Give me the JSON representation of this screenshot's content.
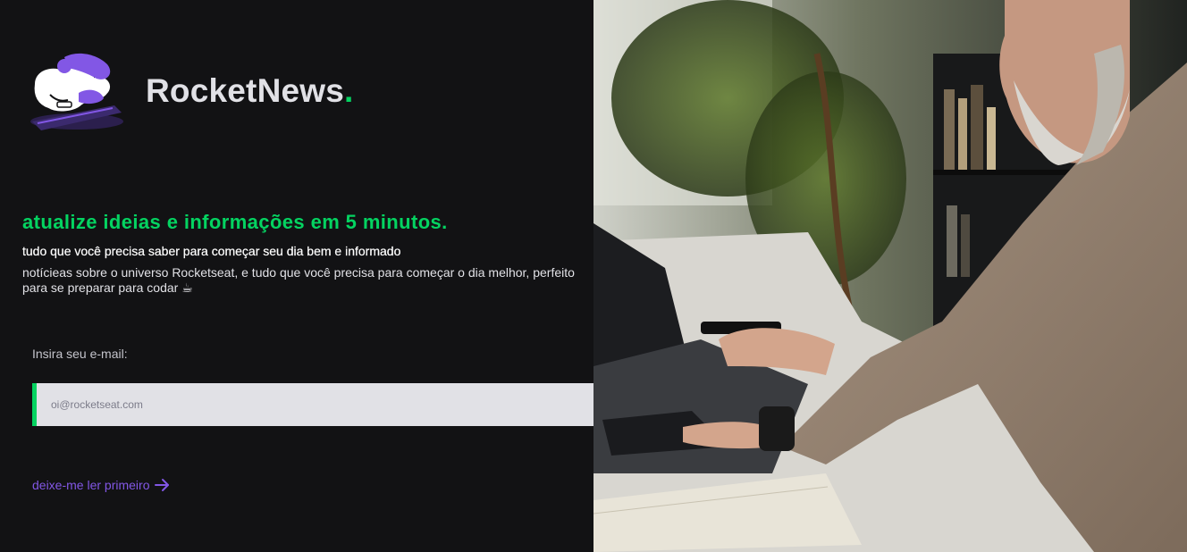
{
  "brand": {
    "name": "RocketNews",
    "dot": "."
  },
  "hero": {
    "headline": "atualize ideias e informações em 5 minutos.",
    "subheadline": "tudo que você precisa saber para começar seu dia bem e informado",
    "description": "notícieas sobre o universo Rocketseat, e tudo que você precisa para começar o dia melhor, perfeito para se preparar para codar ☕"
  },
  "form": {
    "label": "Insira seu e-mail:",
    "placeholder": "oi@rocketseat.com",
    "submit_icon": "send-icon"
  },
  "links": {
    "read_first": "deixe-me ler primeiro",
    "read_first_icon": "arrow-right-icon"
  },
  "colors": {
    "background": "#121214",
    "accent_green": "#04d361",
    "accent_purple": "#8257e5",
    "input_background": "#e1e1e6"
  }
}
